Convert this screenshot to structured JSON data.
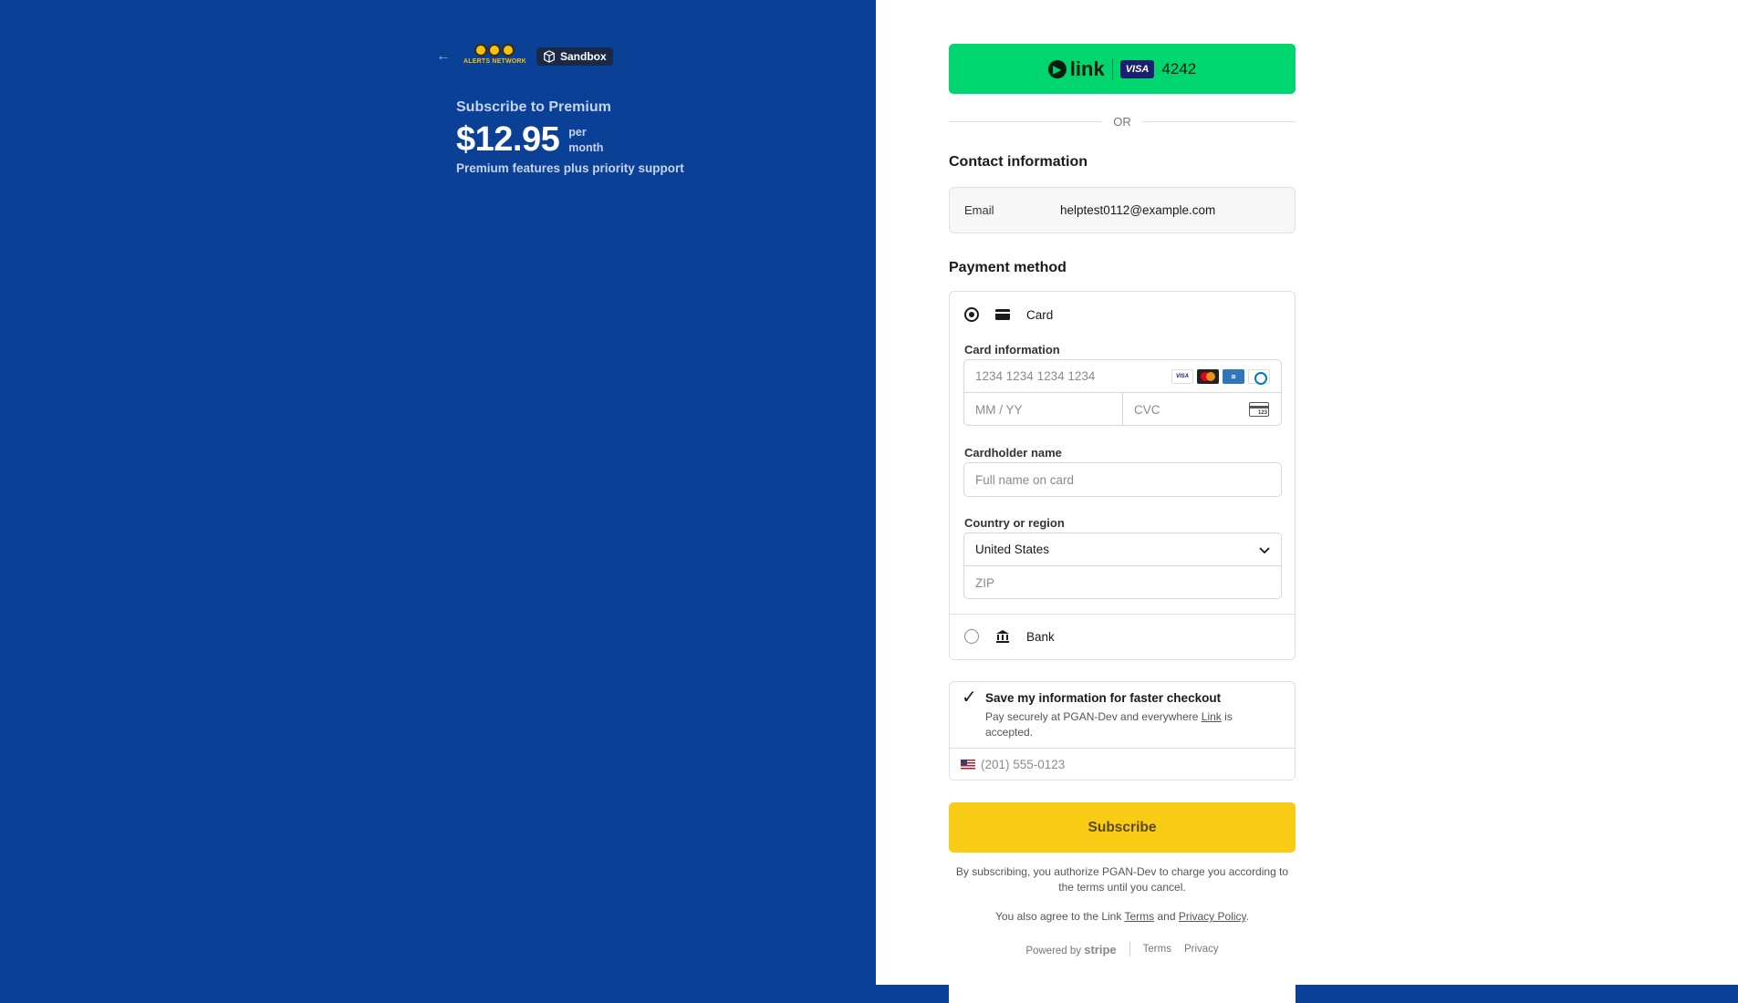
{
  "merchant": {
    "back_icon": "←",
    "logo_text": "ALERTS NETWORK",
    "sandbox_label": "Sandbox"
  },
  "product": {
    "subscribe_label": "Subscribe to Premium",
    "price": "$12.95",
    "per": "per",
    "period": "month",
    "description": "Premium features plus priority support"
  },
  "link_button": {
    "brand": "link",
    "card_brand": "VISA",
    "last4": "4242"
  },
  "divider": {
    "or": "OR"
  },
  "contact": {
    "heading": "Contact information",
    "email_label": "Email",
    "email_value": "helptest0112@example.com"
  },
  "payment": {
    "heading": "Payment method",
    "card_option": "Card",
    "card_info_label": "Card information",
    "card_number_placeholder": "1234 1234 1234 1234",
    "expiry_placeholder": "MM / YY",
    "cvc_placeholder": "CVC",
    "cvc_icon_text": "123",
    "brands": [
      "VISA",
      "MC",
      "AMEX",
      "DC"
    ],
    "cardholder_label": "Cardholder name",
    "cardholder_placeholder": "Full name on card",
    "country_label": "Country or region",
    "country_value": "United States",
    "zip_placeholder": "ZIP",
    "bank_option": "Bank"
  },
  "save_info": {
    "title": "Save my information for faster checkout",
    "sub_prefix": "Pay securely at PGAN-Dev and everywhere ",
    "sub_link": "Link",
    "sub_suffix": " is accepted.",
    "phone_placeholder": "(201) 555-0123"
  },
  "subscribe_button": "Subscribe",
  "legal": {
    "line1": "By subscribing, you authorize PGAN-Dev to charge you according to the terms until you cancel.",
    "line2_prefix": "You also agree to the Link ",
    "terms": "Terms",
    "and": " and ",
    "privacy_policy": "Privacy Policy",
    "period": "."
  },
  "footer": {
    "powered_by": "Powered by",
    "stripe": "stripe",
    "terms": "Terms",
    "privacy": "Privacy"
  },
  "colors": {
    "left_bg": "#0a4095",
    "link_green": "#00d66f",
    "subscribe_yellow": "#f8cb14"
  }
}
